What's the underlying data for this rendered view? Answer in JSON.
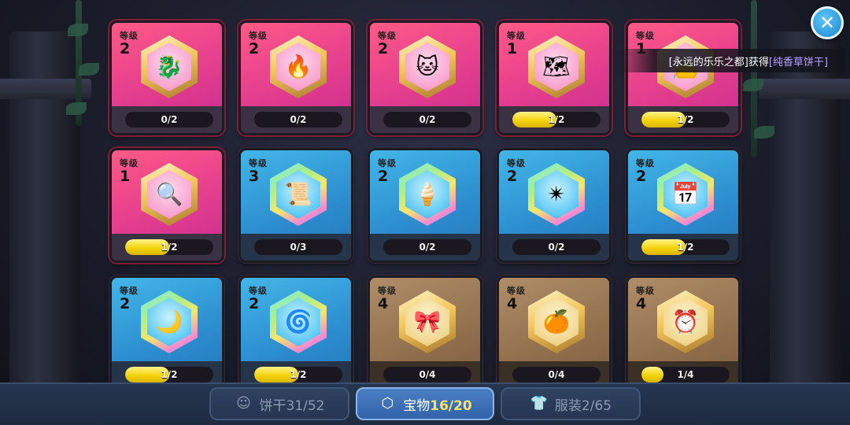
{
  "header": {
    "close_icon": "close-icon"
  },
  "toast": {
    "prefix": "[永远的乐乐之都]获得",
    "item": "[纯香草饼干]"
  },
  "level_label": "等级",
  "cards": [
    {
      "rarity": "pink",
      "frame": true,
      "level": "2",
      "progress_text": "0/2",
      "progress": 0.0,
      "icon": "dragon-emblem-icon",
      "glyph": "🐉"
    },
    {
      "rarity": "pink",
      "frame": true,
      "level": "2",
      "progress_text": "0/2",
      "progress": 0.0,
      "icon": "fire-crown-icon",
      "glyph": "🔥"
    },
    {
      "rarity": "pink",
      "frame": true,
      "level": "2",
      "progress_text": "0/2",
      "progress": 0.0,
      "icon": "pink-cat-jelly-icon",
      "glyph": "🐱"
    },
    {
      "rarity": "pink",
      "frame": true,
      "level": "1",
      "progress_text": "1/2",
      "progress": 0.5,
      "icon": "treasure-map-icon",
      "glyph": "🗺"
    },
    {
      "rarity": "pink",
      "frame": true,
      "level": "1",
      "progress_text": "1/2",
      "progress": 0.5,
      "icon": "pouch-icon",
      "glyph": "👝"
    },
    {
      "rarity": "pink",
      "frame": true,
      "level": "1",
      "progress_text": "1/2",
      "progress": 0.5,
      "icon": "magnifier-icon",
      "glyph": "🔍"
    },
    {
      "rarity": "blue",
      "frame": false,
      "level": "3",
      "progress_text": "0/3",
      "progress": 0.0,
      "icon": "scroll-icon",
      "glyph": "📜"
    },
    {
      "rarity": "blue",
      "frame": false,
      "level": "2",
      "progress_text": "0/2",
      "progress": 0.0,
      "icon": "ice-cream-cone-icon",
      "glyph": "🍦"
    },
    {
      "rarity": "blue",
      "frame": false,
      "level": "2",
      "progress_text": "0/2",
      "progress": 0.0,
      "icon": "spiky-ball-icon",
      "glyph": "✴"
    },
    {
      "rarity": "blue",
      "frame": false,
      "level": "2",
      "progress_text": "1/2",
      "progress": 0.5,
      "icon": "calendar-icon",
      "glyph": "📅"
    },
    {
      "rarity": "blue",
      "frame": false,
      "level": "2",
      "progress_text": "1/2",
      "progress": 0.5,
      "icon": "crescent-wand-icon",
      "glyph": "🌙"
    },
    {
      "rarity": "blue",
      "frame": false,
      "level": "2",
      "progress_text": "1/2",
      "progress": 0.5,
      "icon": "swirl-orb-icon",
      "glyph": "🌀"
    },
    {
      "rarity": "brown",
      "frame": false,
      "level": "4",
      "progress_text": "0/4",
      "progress": 0.0,
      "icon": "purple-scroll-icon",
      "glyph": "🎀"
    },
    {
      "rarity": "brown",
      "frame": false,
      "level": "4",
      "progress_text": "0/4",
      "progress": 0.0,
      "icon": "orange-jelly-icon",
      "glyph": "🍊"
    },
    {
      "rarity": "brown",
      "frame": false,
      "level": "4",
      "progress_text": "1/4",
      "progress": 0.25,
      "icon": "alarm-clock-icon",
      "glyph": "⏰"
    }
  ],
  "tabs": [
    {
      "id": "cookies",
      "label": "饼干",
      "count": "31/52",
      "icon": "cookie-head-icon",
      "glyph": "☺",
      "active": false
    },
    {
      "id": "treasure",
      "label": "宝物",
      "count": "16/20",
      "icon": "hexagon-icon",
      "glyph": "⬡",
      "active": true
    },
    {
      "id": "costume",
      "label": "服装",
      "count": "2/65",
      "icon": "shirt-icon",
      "glyph": "👕",
      "active": false
    }
  ]
}
